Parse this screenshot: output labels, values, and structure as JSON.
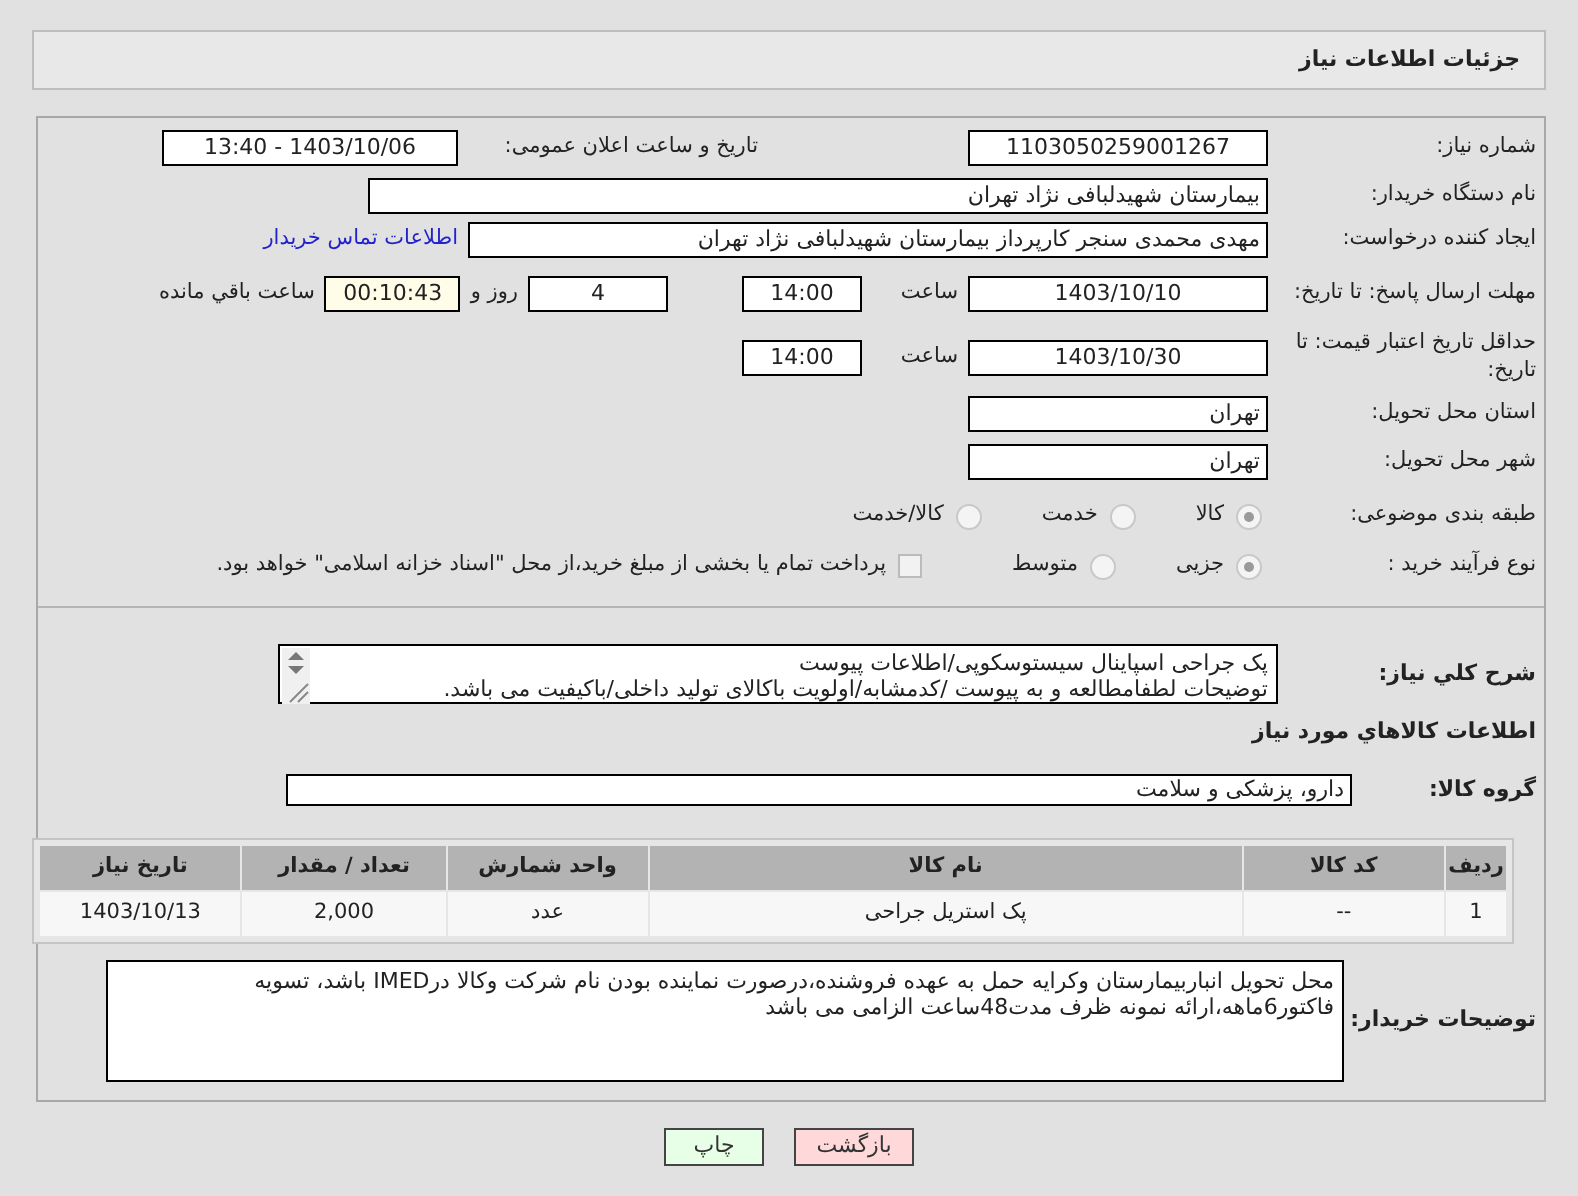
{
  "page_title": "جزئیات اطلاعات نیاز",
  "need_number": {
    "label": "شماره نیاز:",
    "value": "1103050259001267"
  },
  "announce": {
    "label": "تاریخ و ساعت اعلان عمومی:",
    "value": "1403/10/06 - 13:40"
  },
  "buyer_org": {
    "label": "نام دستگاه خریدار:",
    "value": "بیمارستان شهیدلبافی نژاد تهران"
  },
  "requester": {
    "label": "ایجاد کننده درخواست:",
    "value": "مهدی محمدی سنجر کارپرداز بیمارستان شهیدلبافی نژاد تهران",
    "contact_link": "اطلاعات تماس خریدار"
  },
  "reply_deadline": {
    "label": "مهلت ارسال پاسخ: تا تاریخ:",
    "date": "1403/10/10",
    "time_label": "ساعت",
    "time": "14:00",
    "days": "4",
    "days_label": "روز و",
    "remaining": "00:10:43",
    "remaining_label": "ساعت باقي مانده"
  },
  "price_validity": {
    "label": "حداقل تاریخ اعتبار قیمت: تا تاریخ:",
    "date": "1403/10/30",
    "time_label": "ساعت",
    "time": "14:00"
  },
  "province": {
    "label": "استان محل تحویل:",
    "value": "تهران"
  },
  "city": {
    "label": "شهر محل تحویل:",
    "value": "تهران"
  },
  "category": {
    "label": "طبقه بندی موضوعی:",
    "options": [
      {
        "label": "کالا",
        "selected": true
      },
      {
        "label": "خدمت",
        "selected": false
      },
      {
        "label": "کالا/خدمت",
        "selected": false
      }
    ]
  },
  "purchase_type": {
    "label": "نوع فرآیند خرید :",
    "options": [
      {
        "label": "جزیی",
        "selected": true
      },
      {
        "label": "متوسط",
        "selected": false
      }
    ],
    "treasury": {
      "label": "پرداخت تمام یا بخشی از مبلغ خرید،از محل \"اسناد خزانه اسلامی\" خواهد بود.",
      "checked": false
    }
  },
  "description": {
    "label": "شرح کلي نياز:",
    "lines": [
      "پک جراحی اسپاینال سیستوسکوپی/اطلاعات پیوست",
      "توضیحات لطفامطالعه و به پیوست /کدمشابه/اولویت باکالای تولید داخلی/باکیفیت می باشد."
    ]
  },
  "goods_heading": "اطلاعات كالاهاي مورد نياز",
  "goods_group": {
    "label": "گروه کالا:",
    "value": "دارو، پزشکی و سلامت"
  },
  "table": {
    "columns": [
      "ردیف",
      "کد کالا",
      "نام کالا",
      "واحد شمارش",
      "تعداد / مقدار",
      "تاریخ نیاز"
    ],
    "rows": [
      [
        "1",
        "--",
        "پک استریل جراحی",
        "عدد",
        "2,000",
        "1403/10/13"
      ]
    ]
  },
  "buyer_notes": {
    "label": "توضیحات خریدار:",
    "text": "محل تحویل انباربیمارستان وکرایه حمل به عهده فروشنده،درصورت نماینده بودن نام شرکت وکالا درIMED باشد، تسویه فاکتور6ماهه،ارائه نمونه ظرف مدت48ساعت الزامی می باشد"
  },
  "buttons": [
    {
      "label": "بازگشت",
      "kind": "back"
    },
    {
      "label": "چاپ",
      "kind": "print"
    }
  ]
}
